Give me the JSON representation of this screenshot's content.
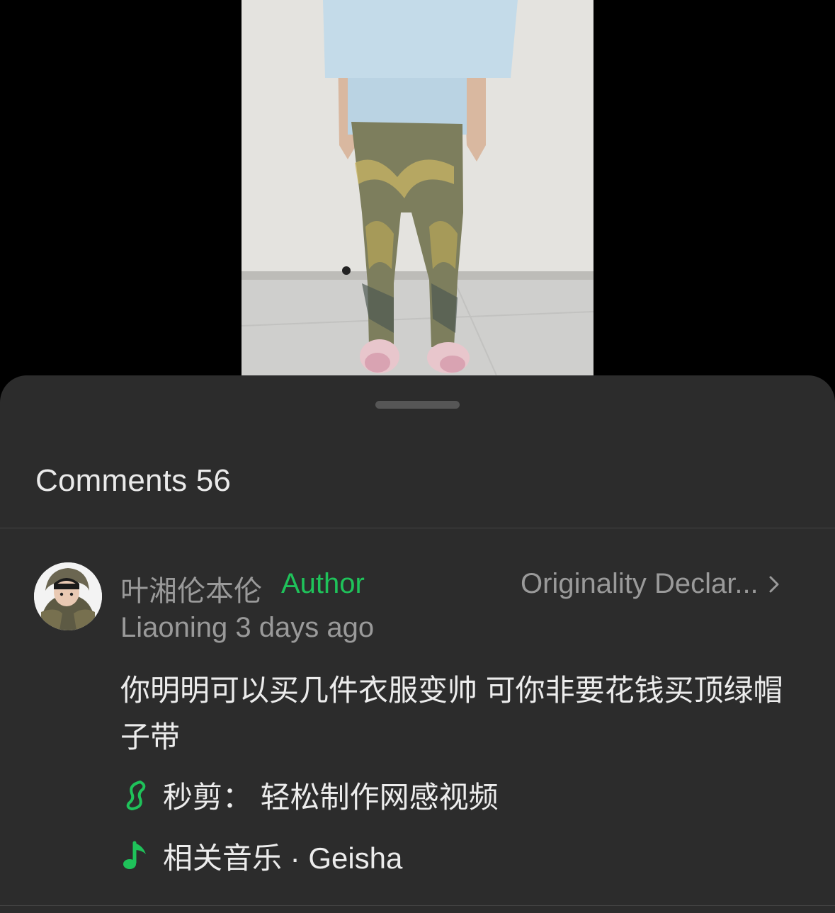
{
  "comments_sheet": {
    "title": "Comments 56"
  },
  "comment": {
    "author_name": "叶湘伦本伦",
    "author_badge": "Author",
    "declaration_link": "Originality Declar...",
    "meta": "Liaoning 3 days ago",
    "text": "你明明可以买几件衣服变帅 可你非要花钱买顶绿帽子带"
  },
  "links": {
    "miaojian": "秒剪：  轻松制作网感视频",
    "music": "相关音乐 · Geisha"
  },
  "icons": {
    "video": "video-frame",
    "avatar": "avatar-photo",
    "chevron": "chevron-right-icon",
    "miaojian": "miaojian-app-icon",
    "music": "music-note-icon"
  },
  "colors": {
    "sheet_bg": "#2c2c2c",
    "accent_green": "#1fc25a",
    "muted_text": "#9a9a9a",
    "primary_text": "#ececec"
  }
}
